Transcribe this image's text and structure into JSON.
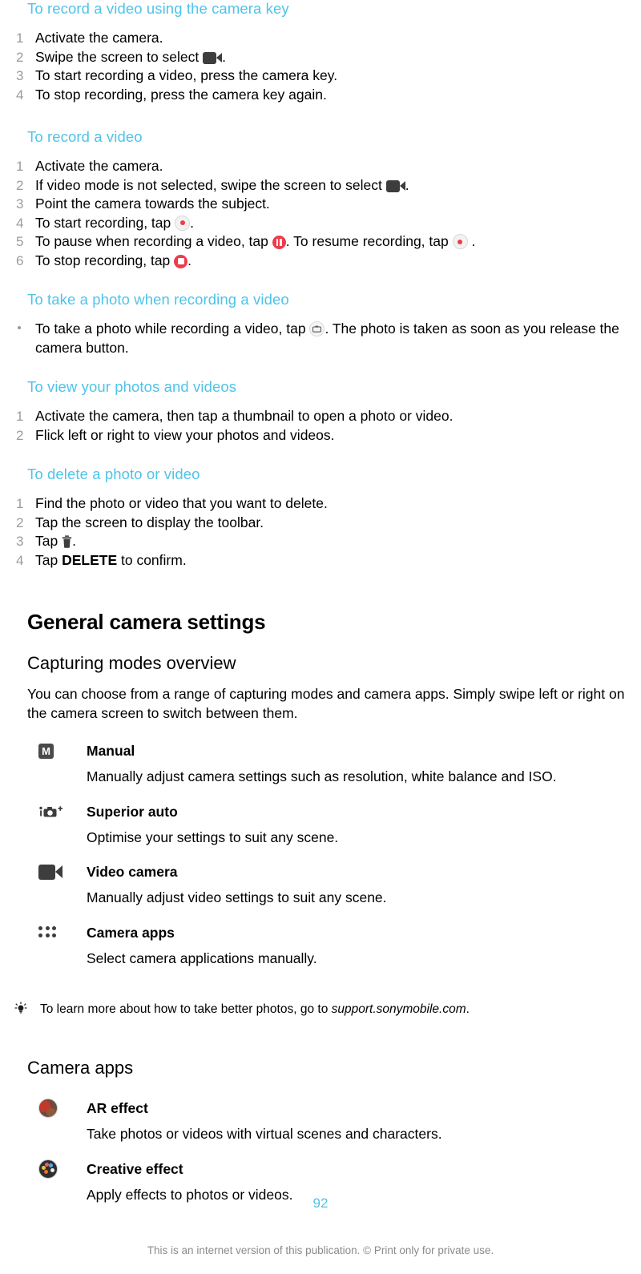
{
  "colors": {
    "heading_cyan": "#4FC3E8",
    "number_gray": "#9b9b9b",
    "icon_dark": "#3d3d3d",
    "record_red": "#ee3b4b",
    "footer_gray": "#8b8b8b"
  },
  "sections": {
    "record_with_key": {
      "heading": "To record a video using the camera key",
      "steps": [
        {
          "num": "1",
          "text_before": "Activate the camera.",
          "icon": null,
          "text_after": ""
        },
        {
          "num": "2",
          "text_before": "Swipe the screen to select ",
          "icon": "video-camera-icon",
          "text_after": "."
        },
        {
          "num": "3",
          "text_before": "To start recording a video, press the camera key.",
          "icon": null,
          "text_after": ""
        },
        {
          "num": "4",
          "text_before": "To stop recording, press the camera key again.",
          "icon": null,
          "text_after": ""
        }
      ]
    },
    "record_a_video": {
      "heading": "To record a video",
      "steps": [
        {
          "num": "1",
          "text_before": "Activate the camera.",
          "icon": null,
          "text_after": ""
        },
        {
          "num": "2",
          "text_before": "If video mode is not selected, swipe the screen to select ",
          "icon": "video-camera-icon",
          "text_after": "."
        },
        {
          "num": "3",
          "text_before": "Point the camera towards the subject.",
          "icon": null,
          "text_after": ""
        },
        {
          "num": "4",
          "text_before": "To start recording, tap ",
          "icon": "record-icon",
          "text_after": "."
        },
        {
          "num": "5",
          "text_before": "To pause when recording a video, tap ",
          "icon": "pause-icon",
          "text_mid": ". To resume recording, tap ",
          "icon2": "record-icon",
          "text_after": " ."
        },
        {
          "num": "6",
          "text_before": "To stop recording, tap ",
          "icon": "stop-icon",
          "text_after": "."
        }
      ]
    },
    "photo_while_recording": {
      "heading": "To take a photo when recording a video",
      "bullet_before": "To take a photo while recording a video, tap ",
      "bullet_icon": "shutter-icon",
      "bullet_after": ". The photo is taken as soon as you release the camera button."
    },
    "view_photos": {
      "heading": "To view your photos and videos",
      "steps": [
        {
          "num": "1",
          "text": "Activate the camera, then tap a thumbnail to open a photo or video."
        },
        {
          "num": "2",
          "text": "Flick left or right to view your photos and videos."
        }
      ]
    },
    "delete": {
      "heading": "To delete a photo or video",
      "steps": [
        {
          "num": "1",
          "text_before": "Find the photo or video that you want to delete.",
          "icon": null,
          "text_after": ""
        },
        {
          "num": "2",
          "text_before": "Tap the screen to display the toolbar.",
          "icon": null,
          "text_after": ""
        },
        {
          "num": "3",
          "text_before": "Tap ",
          "icon": "trash-icon",
          "text_after": "."
        },
        {
          "num": "4",
          "text_before": "Tap ",
          "bold": "DELETE",
          "text_after": " to confirm."
        }
      ]
    },
    "general_camera_settings": {
      "title": "General camera settings",
      "subtitle": "Capturing modes overview",
      "intro": "You can choose from a range of capturing modes and camera apps. Simply swipe left or right on the camera screen to switch between them.",
      "modes": [
        {
          "icon": "manual-m-icon",
          "title": "Manual",
          "desc": "Manually adjust camera settings such as resolution, white balance and ISO."
        },
        {
          "icon": "superior-auto-icon",
          "title": "Superior auto",
          "desc": "Optimise your settings to suit any scene."
        },
        {
          "icon": "video-camera-icon",
          "title": "Video camera",
          "desc": "Manually adjust video settings to suit any scene."
        },
        {
          "icon": "camera-apps-grid-icon",
          "title": "Camera apps",
          "desc": "Select camera applications manually."
        }
      ]
    },
    "tip": {
      "icon": "lightbulb-icon",
      "text_before": "To learn more about how to take better photos, go to ",
      "link_text": "support.sonymobile.com",
      "text_after": "."
    },
    "camera_apps": {
      "title": "Camera apps",
      "apps": [
        {
          "icon": "ar-effect-icon",
          "title": "AR effect",
          "desc": "Take photos or videos with virtual scenes and characters."
        },
        {
          "icon": "creative-effect-icon",
          "title": "Creative effect",
          "desc": "Apply effects to photos or videos."
        }
      ]
    }
  },
  "footer": {
    "page_number": "92",
    "note": "This is an internet version of this publication. © Print only for private use."
  }
}
